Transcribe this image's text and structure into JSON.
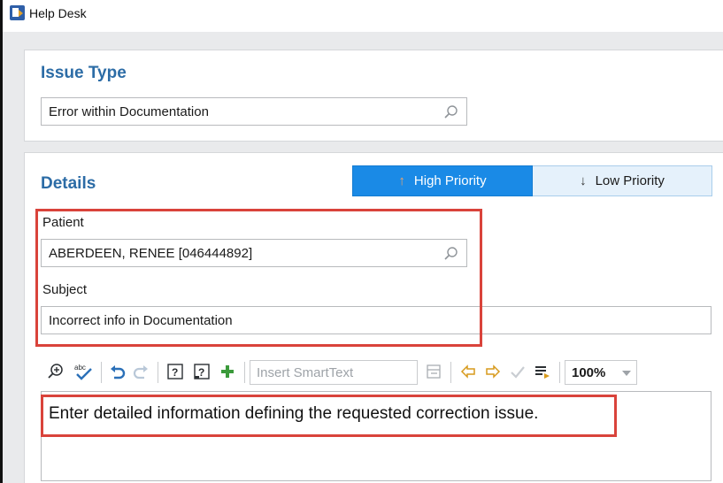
{
  "window": {
    "title": "Help Desk"
  },
  "issue_type": {
    "heading": "Issue Type",
    "value": "Error within Documentation"
  },
  "details": {
    "heading": "Details",
    "priority": {
      "high_label": "High Priority",
      "low_label": "Low Priority",
      "selected": "High Priority",
      "high_color": "#1a8ae6",
      "low_color": "#e5f1fb"
    },
    "patient": {
      "label": "Patient",
      "value": "ABERDEEN, RENEE [046444892]"
    },
    "subject": {
      "label": "Subject",
      "value": "Incorrect info in Documentation"
    }
  },
  "toolbar": {
    "icons": [
      "zoom-in-icon",
      "spell-check-icon",
      "undo-icon",
      "redo-icon",
      "help-icon",
      "smart-help-icon",
      "add-icon",
      "smarttext-list-icon",
      "previous-icon",
      "next-icon",
      "approve-icon",
      "summary-icon"
    ],
    "smarttext_placeholder": "Insert SmartText",
    "zoom_value": "100%"
  },
  "editor": {
    "text": "Enter detailed information defining the requested correction issue."
  },
  "colors": {
    "accent": "#2c6ca6",
    "highlight": "#d9433b"
  }
}
